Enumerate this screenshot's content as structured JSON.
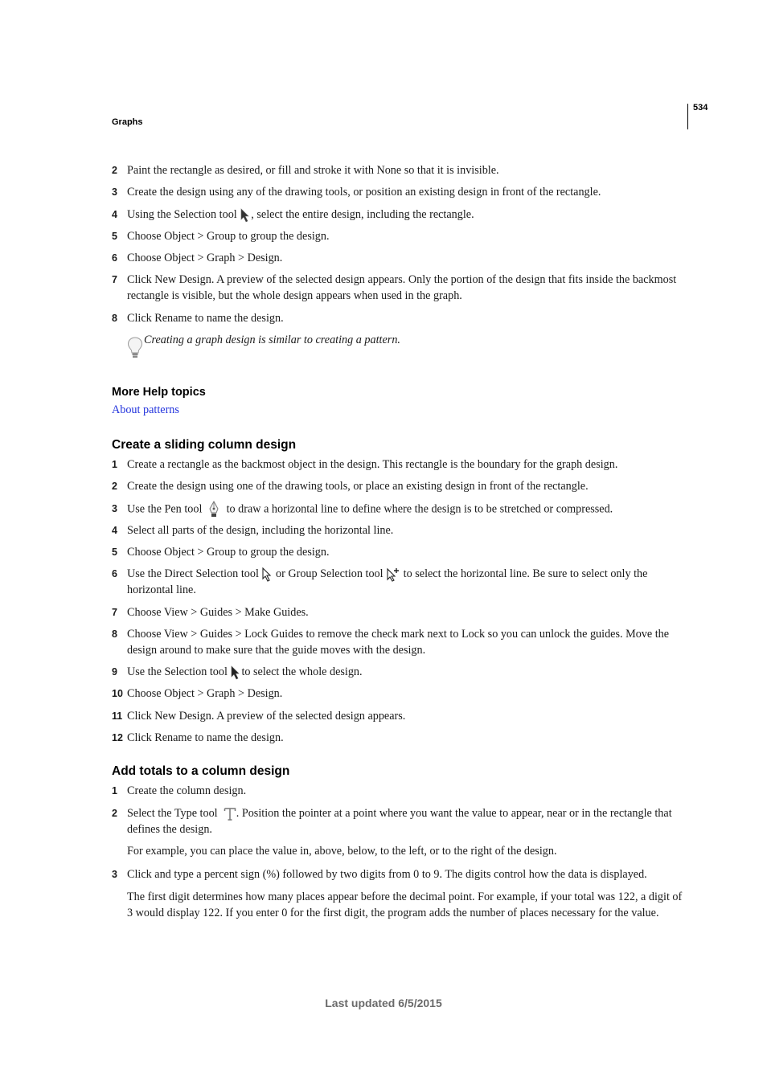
{
  "header": {
    "running_head": "Graphs",
    "page_number": "534"
  },
  "section_intro": {
    "steps": [
      {
        "num": "2",
        "text": "Paint the rectangle as desired, or fill and stroke it with None so that it is invisible."
      },
      {
        "num": "3",
        "text": "Create the design using any of the drawing tools, or position an existing design in front of the rectangle."
      },
      {
        "num": "4",
        "text_before": "Using the Selection tool",
        "icon": "selection-tool-icon",
        "text_after": ", select the entire design, including the rectangle."
      },
      {
        "num": "5",
        "text": "Choose Object > Group to group the design."
      },
      {
        "num": "6",
        "text": "Choose Object > Graph > Design."
      },
      {
        "num": "7",
        "text": "Click New Design. A preview of the selected design appears. Only the portion of the design that fits inside the backmost rectangle is visible, but the whole design appears when used in the graph."
      },
      {
        "num": "8",
        "text": "Click Rename to name the design."
      }
    ],
    "tip": {
      "icon": "lightbulb-icon",
      "text": "Creating a graph design is similar to creating a pattern."
    }
  },
  "more_help": {
    "heading": "More Help topics",
    "links": [
      "About patterns"
    ]
  },
  "sliding_column": {
    "heading": "Create a sliding column design",
    "steps": [
      {
        "num": "1",
        "text": "Create a rectangle as the backmost object in the design. This rectangle is the boundary for the graph design."
      },
      {
        "num": "2",
        "text": "Create the design using one of the drawing tools, or place an existing design in front of the rectangle."
      },
      {
        "num": "3",
        "text_before": "Use the Pen tool",
        "icon": "pen-tool-icon",
        "text_after": "to draw a horizontal line to define where the design is to be stretched or compressed."
      },
      {
        "num": "4",
        "text": "Select all parts of the design, including the horizontal line."
      },
      {
        "num": "5",
        "text": "Choose Object > Group to group the design."
      },
      {
        "num": "6",
        "text_before": "Use the Direct Selection tool",
        "icon": "direct-selection-tool-icon",
        "text_middle": "or Group Selection tool",
        "icon2": "group-selection-tool-icon",
        "text_after": "to select the horizontal line. Be sure to select only the horizontal line."
      },
      {
        "num": "7",
        "text": "Choose View > Guides > Make Guides."
      },
      {
        "num": "8",
        "text": "Choose View > Guides > Lock Guides to remove the check mark next to Lock so you can unlock the guides. Move the design around to make sure that the guide moves with the design."
      },
      {
        "num": "9",
        "text_before": "Use the Selection tool",
        "icon": "selection-tool-icon",
        "text_after": "to select the whole design."
      },
      {
        "num": "10",
        "text": "Choose Object > Graph > Design."
      },
      {
        "num": "11",
        "text": "Click New Design. A preview of the selected design appears."
      },
      {
        "num": "12",
        "text": "Click Rename to name the design."
      }
    ]
  },
  "add_totals": {
    "heading": "Add totals to a column design",
    "steps": [
      {
        "num": "1",
        "text": "Create the column design."
      },
      {
        "num": "2",
        "text_before": "Select the Type tool",
        "icon": "type-tool-icon",
        "text_after": ". Position the pointer at a point where you want the value to appear, near or in the rectangle that defines the design."
      },
      {
        "num": "3",
        "text": "Click and type a percent sign (%) followed by two digits from 0 to 9. The digits control how the data is displayed."
      }
    ],
    "step2_note": "For example, you can place the value in, above, below, to the left, or to the right of the design.",
    "step3_note": "The first digit determines how many places appear before the decimal point. For example, if your total was 122, a digit of 3 would display 122. If you enter 0 for the first digit, the program adds the number of places necessary for the value."
  },
  "footer": {
    "last_updated": "Last updated 6/5/2015"
  },
  "colors": {
    "link": "#2233dd",
    "footer_text": "#6a6a6a",
    "body_text": "#1a1a1a"
  }
}
